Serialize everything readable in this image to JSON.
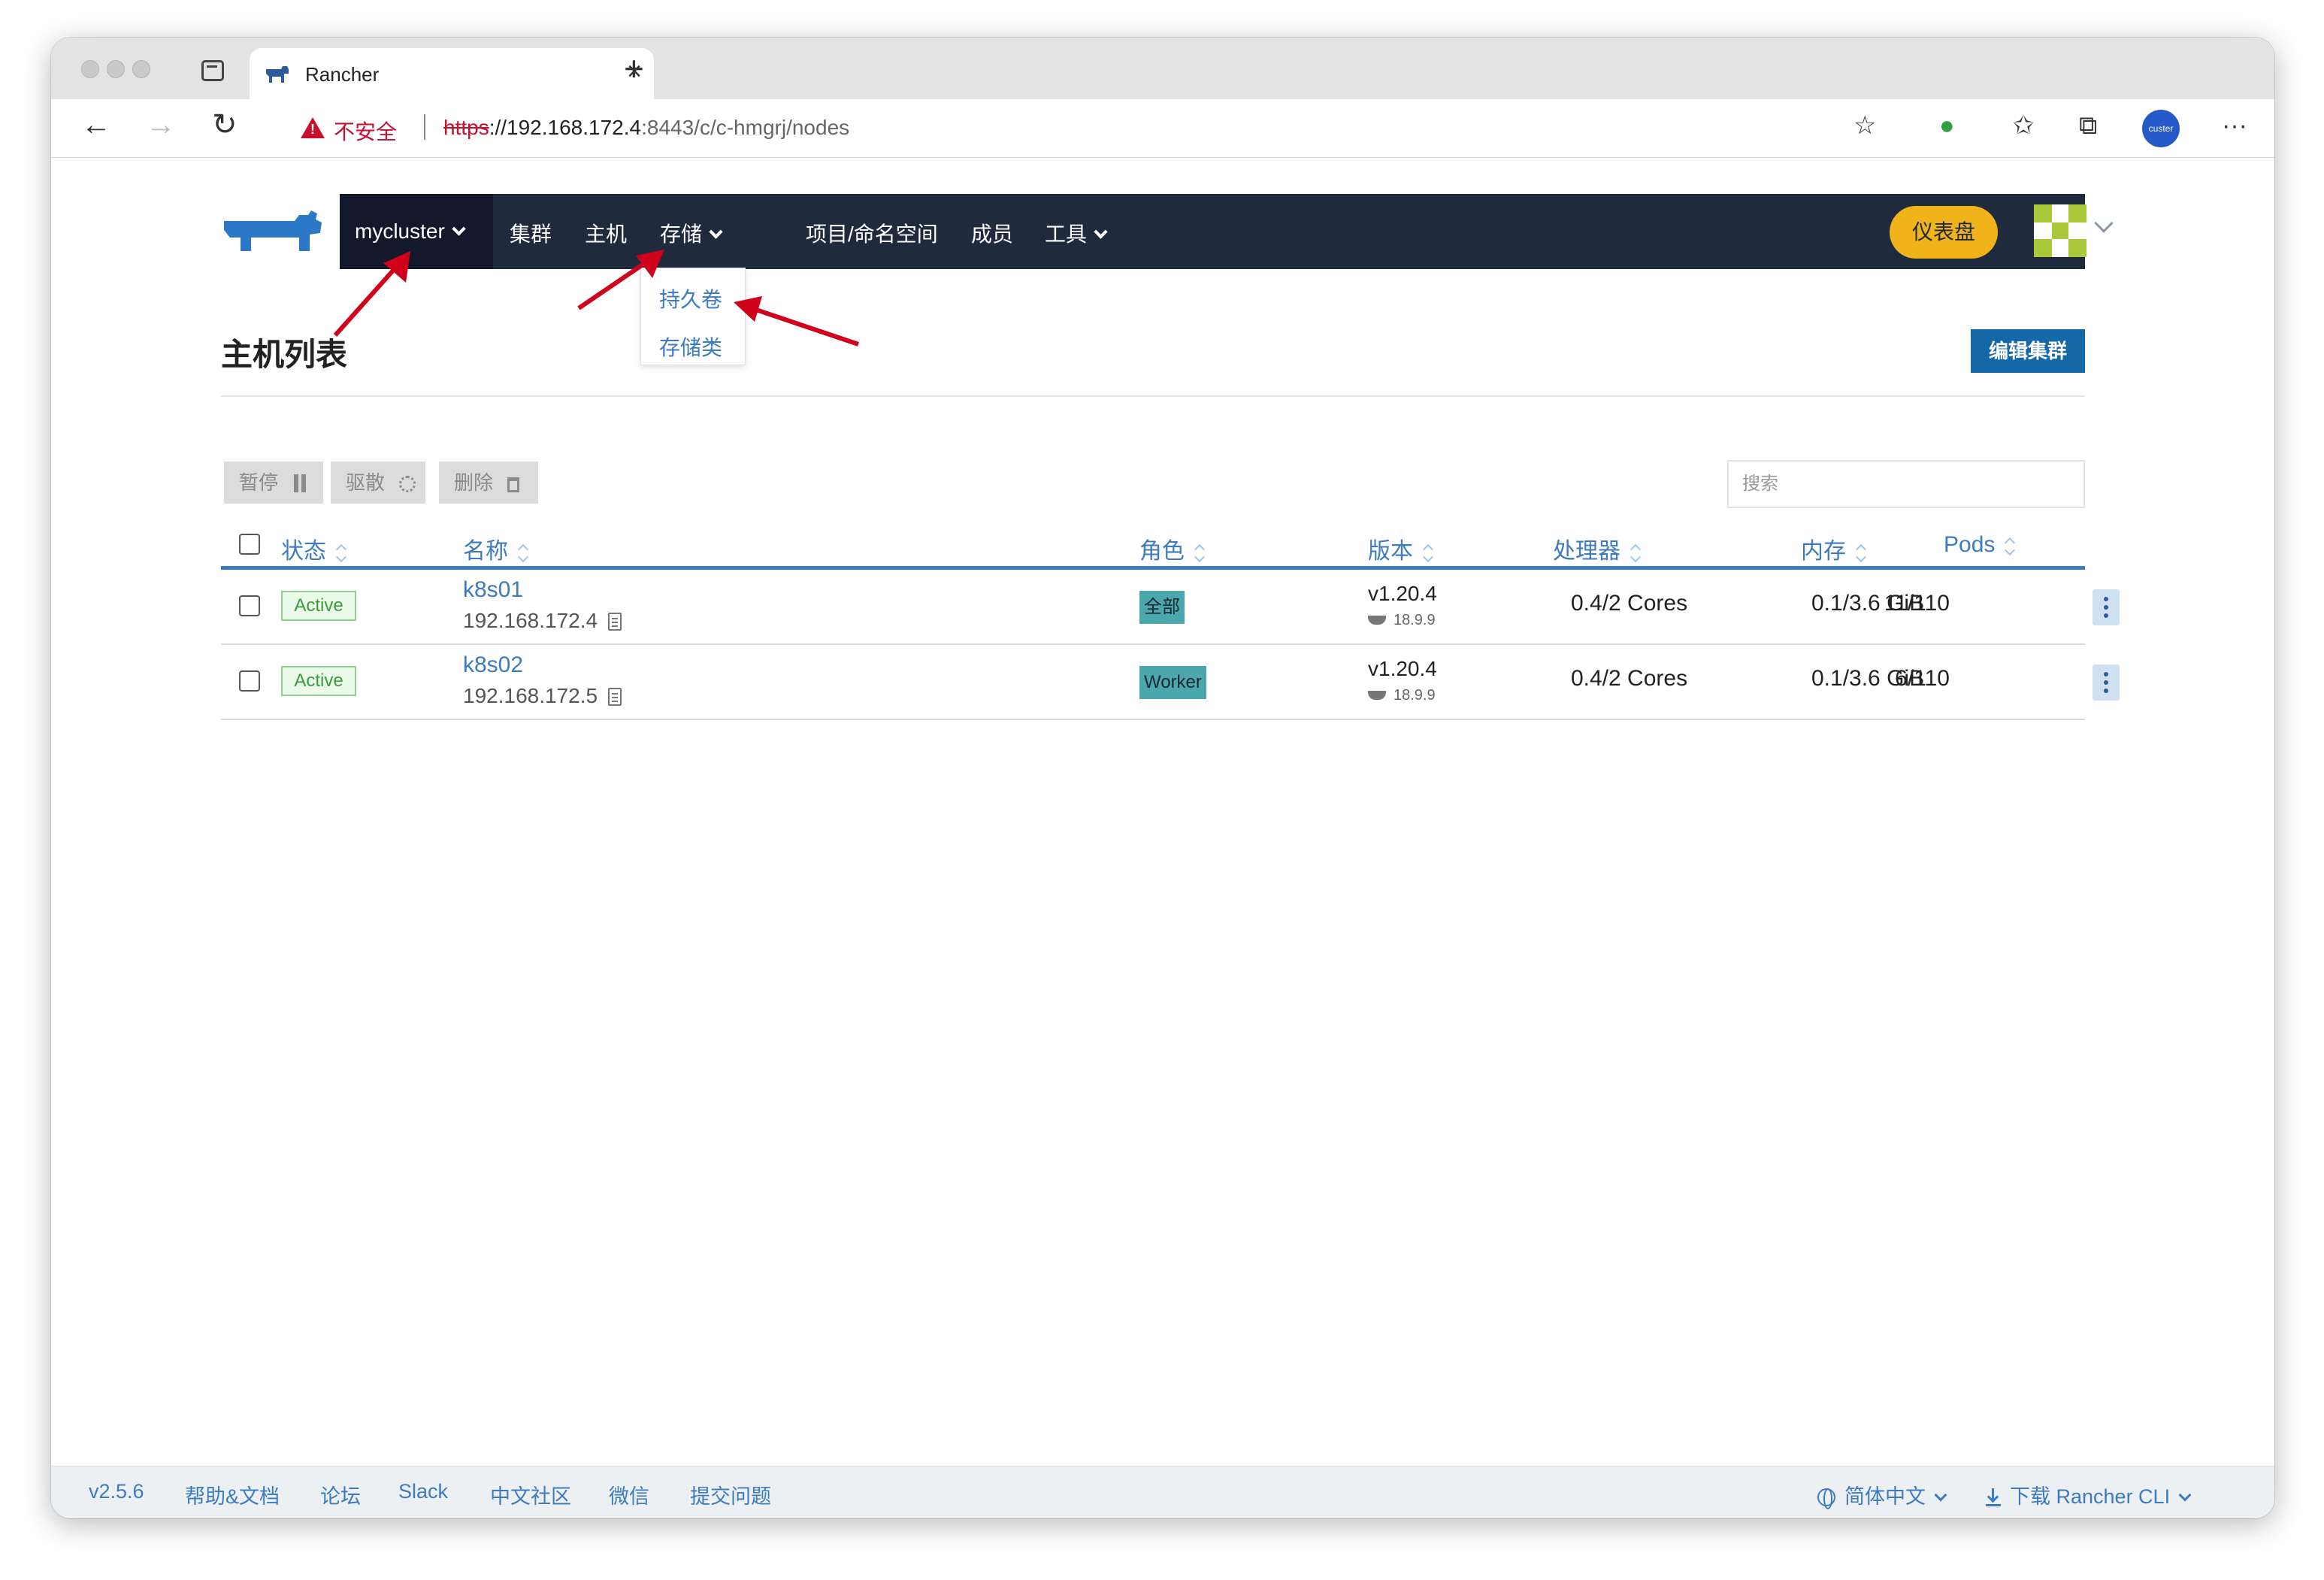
{
  "browser": {
    "tab_title": "Rancher",
    "new_tab": "+",
    "close_tab": "×",
    "security_label": "不安全",
    "url_scheme": "https",
    "url_host": "://192.168.172.4",
    "url_rest": ":8443/c/c-hmgrj/nodes",
    "profile_label": "custer"
  },
  "nav": {
    "cluster": "mycluster",
    "items": [
      "集群",
      "主机",
      "存储",
      "项目/命名空间",
      "成员",
      "工具"
    ],
    "dashboard": "仪表盘"
  },
  "storage_dropdown": [
    "持久卷",
    "存储类"
  ],
  "page": {
    "title": "主机列表",
    "edit_cluster": "编辑集群",
    "search_placeholder": "搜索"
  },
  "actions": [
    {
      "label": "暂停",
      "icon": "pause-icon"
    },
    {
      "label": "驱散",
      "icon": "refresh-icon"
    },
    {
      "label": "删除",
      "icon": "trash-icon"
    }
  ],
  "table": {
    "headers": [
      "状态",
      "名称",
      "角色",
      "版本",
      "处理器",
      "内存",
      "Pods"
    ],
    "rows": [
      {
        "state": "Active",
        "name": "k8s01",
        "ip": "192.168.172.4",
        "role": "全部",
        "version": "v1.20.4",
        "docker": "18.9.9",
        "cpu": "0.4/2 Cores",
        "memory": "0.1/3.6 GiB",
        "pods": "11/110"
      },
      {
        "state": "Active",
        "name": "k8s02",
        "ip": "192.168.172.5",
        "role": "Worker",
        "version": "v1.20.4",
        "docker": "18.9.9",
        "cpu": "0.4/2 Cores",
        "memory": "0.1/3.6 GiB",
        "pods": "6/110"
      }
    ]
  },
  "footer": {
    "version": "v2.5.6",
    "links": [
      "帮助&文档",
      "论坛",
      "Slack",
      "中文社区",
      "微信",
      "提交问题"
    ],
    "language": "简体中文",
    "download": "下载 Rancher CLI"
  },
  "colors": {
    "navbar": "#1f2b3d",
    "accent": "#3d7bbf",
    "dashboard": "#f0b41a",
    "active": "#3c9a3c",
    "annotation": "#d0021b"
  }
}
